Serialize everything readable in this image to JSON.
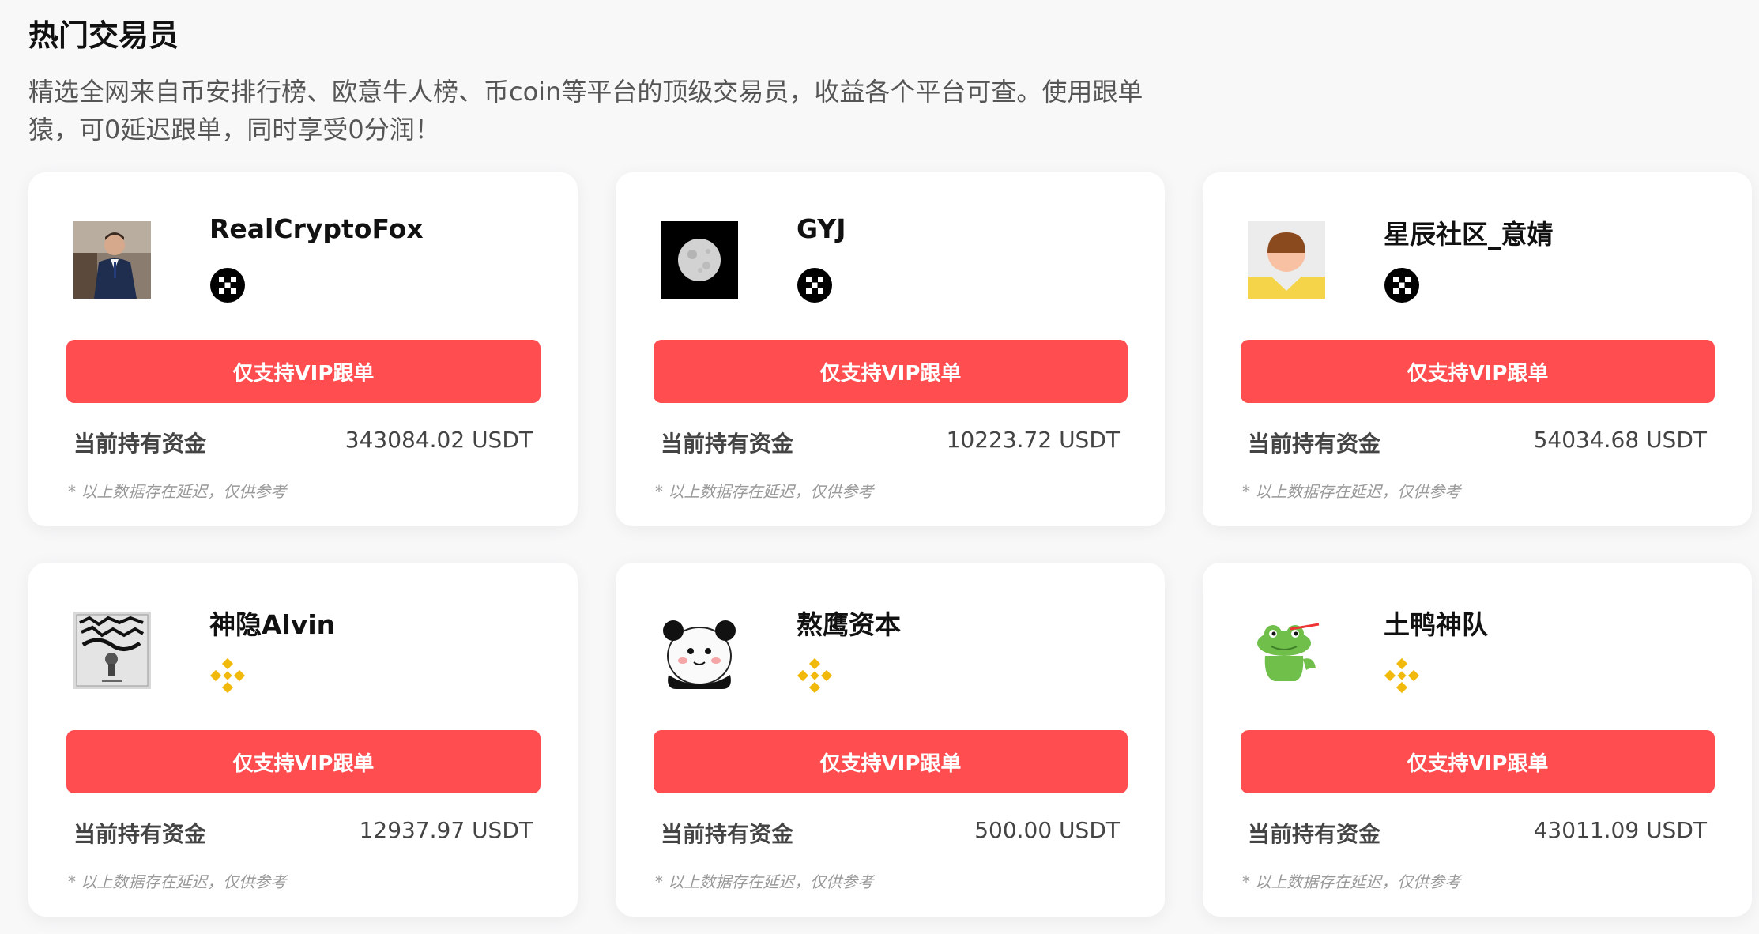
{
  "header": {
    "title": "热门交易员",
    "description": "精选全网来自币安排行榜、欧意牛人榜、币coin等平台的顶级交易员，收益各个平台可查。使用跟单猿，可0延迟跟单，同时享受0分润！"
  },
  "colors": {
    "accent": "#ff4d50",
    "binance": "#F0B90B",
    "okx": "#000000"
  },
  "traders": [
    {
      "name": "RealCryptoFox",
      "avatar": "suited-man-photo",
      "exchange": "okx-icon",
      "button_label": "仅支持VIP跟单",
      "fund_label": "当前持有资金",
      "fund_value": "343084.02 USDT",
      "disclaimer": "* 以上数据存在延迟，仅供参考"
    },
    {
      "name": "GYJ",
      "avatar": "moon-photo",
      "exchange": "okx-icon",
      "button_label": "仅支持VIP跟单",
      "fund_label": "当前持有资金",
      "fund_value": "10223.72 USDT",
      "disclaimer": "* 以上数据存在延迟，仅供参考"
    },
    {
      "name": "星辰社区_意婧",
      "avatar": "default-avatar",
      "exchange": "okx-icon",
      "button_label": "仅支持VIP跟单",
      "fund_label": "当前持有资金",
      "fund_value": "54034.68 USDT",
      "disclaimer": "* 以上数据存在延迟，仅供参考"
    },
    {
      "name": "神隐Alvin",
      "avatar": "album-cover",
      "exchange": "binance-icon",
      "button_label": "仅支持VIP跟单",
      "fund_label": "当前持有资金",
      "fund_value": "12937.97 USDT",
      "disclaimer": "* 以上数据存在延迟，仅供参考"
    },
    {
      "name": "熬鹰资本",
      "avatar": "panda-meme",
      "exchange": "binance-icon",
      "button_label": "仅支持VIP跟单",
      "fund_label": "当前持有资金",
      "fund_value": "500.00 USDT",
      "disclaimer": "* 以上数据存在延迟，仅供参考"
    },
    {
      "name": "土鸭神队",
      "avatar": "green-frog-cartoon",
      "exchange": "binance-icon",
      "button_label": "仅支持VIP跟单",
      "fund_label": "当前持有资金",
      "fund_value": "43011.09 USDT",
      "disclaimer": "* 以上数据存在延迟，仅供参考"
    }
  ]
}
